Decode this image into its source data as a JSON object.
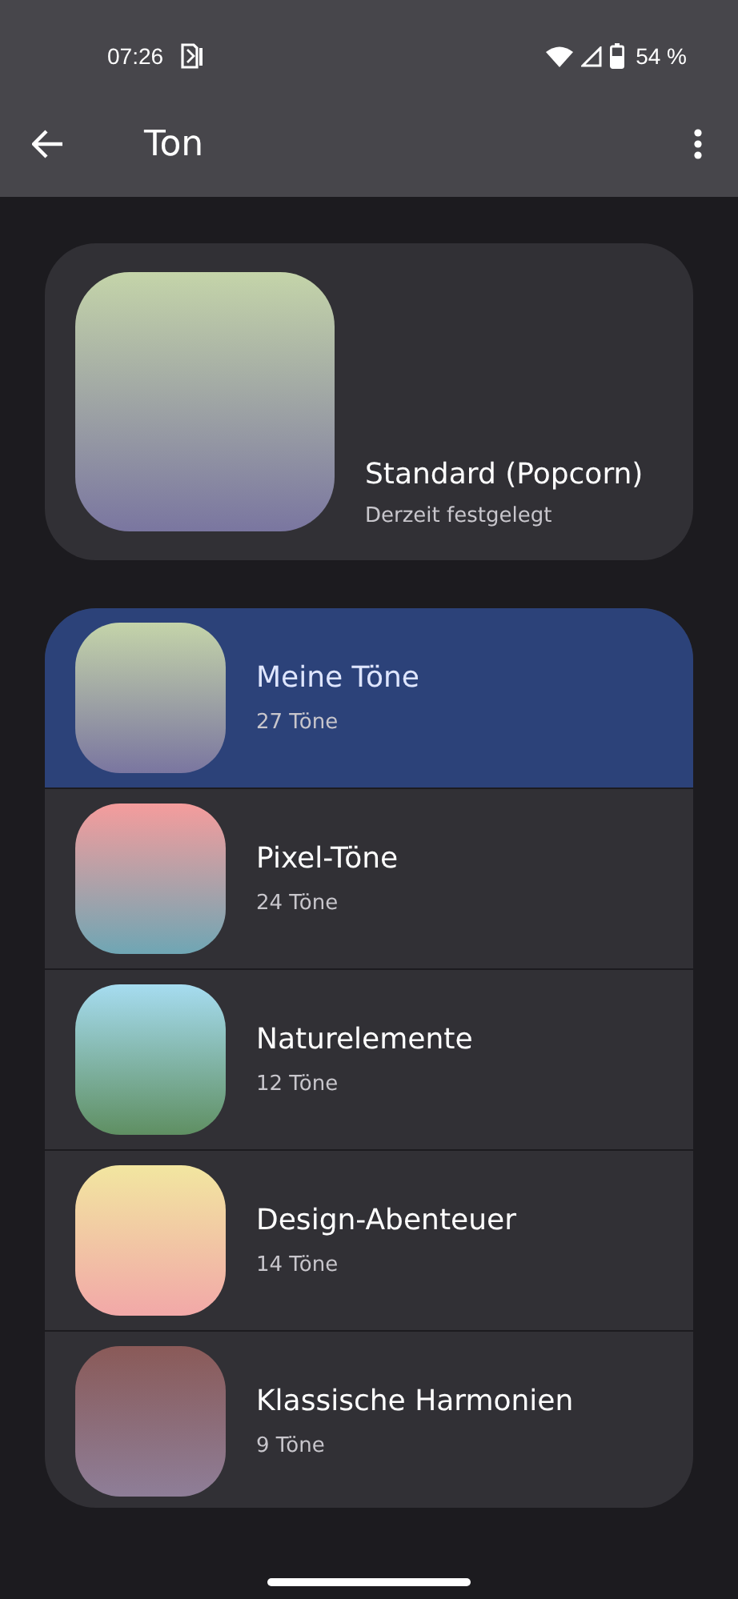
{
  "status_bar": {
    "time": "07:26",
    "battery": "54 %"
  },
  "app_bar": {
    "title": "Ton"
  },
  "current": {
    "title": "Standard (Popcorn)",
    "subtitle": "Derzeit festgelegt",
    "color": "#c4d4a9"
  },
  "categories": [
    {
      "name": "Meine Töne",
      "count": "27 Töne",
      "selected": true,
      "color": "#c4d4a9"
    },
    {
      "name": "Pixel-Töne",
      "count": "24 Töne",
      "selected": false,
      "color": "#f59c9c"
    },
    {
      "name": "Naturelemente",
      "count": "12 Töne",
      "selected": false,
      "color": "#a6dcf0"
    },
    {
      "name": "Design-Abenteuer",
      "count": "14 Töne",
      "selected": false,
      "color": "#f2e6a0"
    },
    {
      "name": "Klassische Harmonien",
      "count": "9 Töne",
      "selected": false,
      "color": "#8a5a58"
    }
  ]
}
